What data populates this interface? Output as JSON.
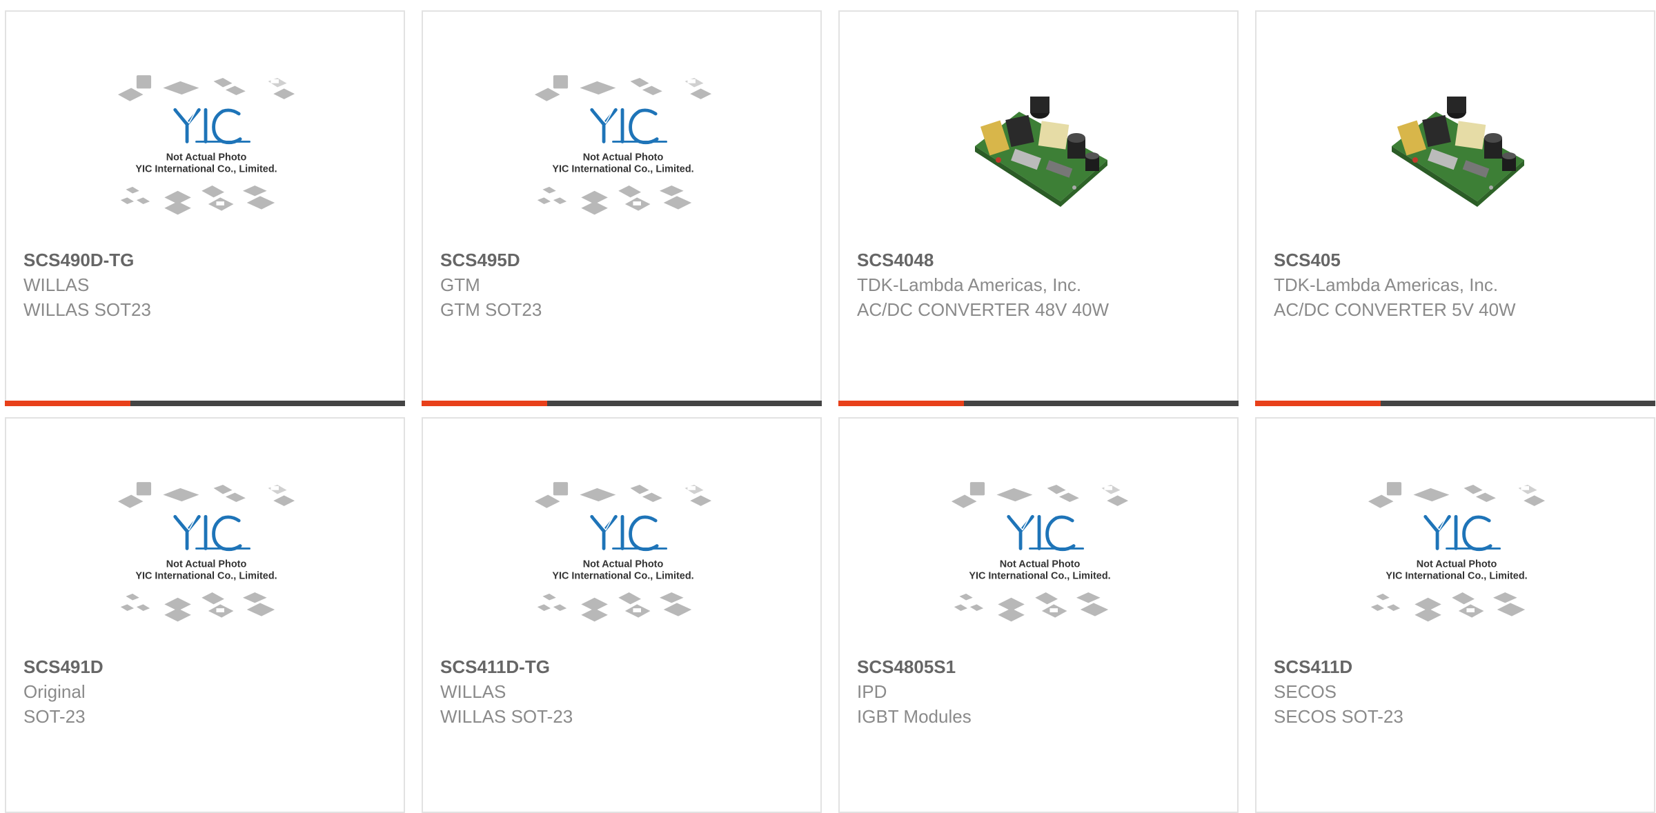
{
  "colors": {
    "accent": "#e8401a",
    "bar": "#444444",
    "logo_blue": "#2a7fc1",
    "border": "#e2e2e2"
  },
  "placeholder": {
    "logo_text": "YIC",
    "line1": "Not Actual Photo",
    "line2": "YIC International Co., Limited."
  },
  "products": [
    {
      "part": "SCS490D-TG",
      "manufacturer": "WILLAS",
      "description": "WILLAS SOT23",
      "image": "placeholder"
    },
    {
      "part": "SCS495D",
      "manufacturer": "GTM",
      "description": "GTM SOT23",
      "image": "placeholder"
    },
    {
      "part": "SCS4048",
      "manufacturer": "TDK-Lambda Americas, Inc.",
      "description": "AC/DC CONVERTER 48V 40W",
      "image": "pcb"
    },
    {
      "part": "SCS405",
      "manufacturer": "TDK-Lambda Americas, Inc.",
      "description": "AC/DC CONVERTER 5V 40W",
      "image": "pcb"
    },
    {
      "part": "SCS491D",
      "manufacturer": "Original",
      "description": "SOT-23",
      "image": "placeholder"
    },
    {
      "part": "SCS411D-TG",
      "manufacturer": "WILLAS",
      "description": "WILLAS SOT-23",
      "image": "placeholder"
    },
    {
      "part": "SCS4805S1",
      "manufacturer": "IPD",
      "description": "IGBT Modules",
      "image": "placeholder"
    },
    {
      "part": "SCS411D",
      "manufacturer": "SECOS",
      "description": "SECOS SOT-23",
      "image": "placeholder"
    }
  ]
}
